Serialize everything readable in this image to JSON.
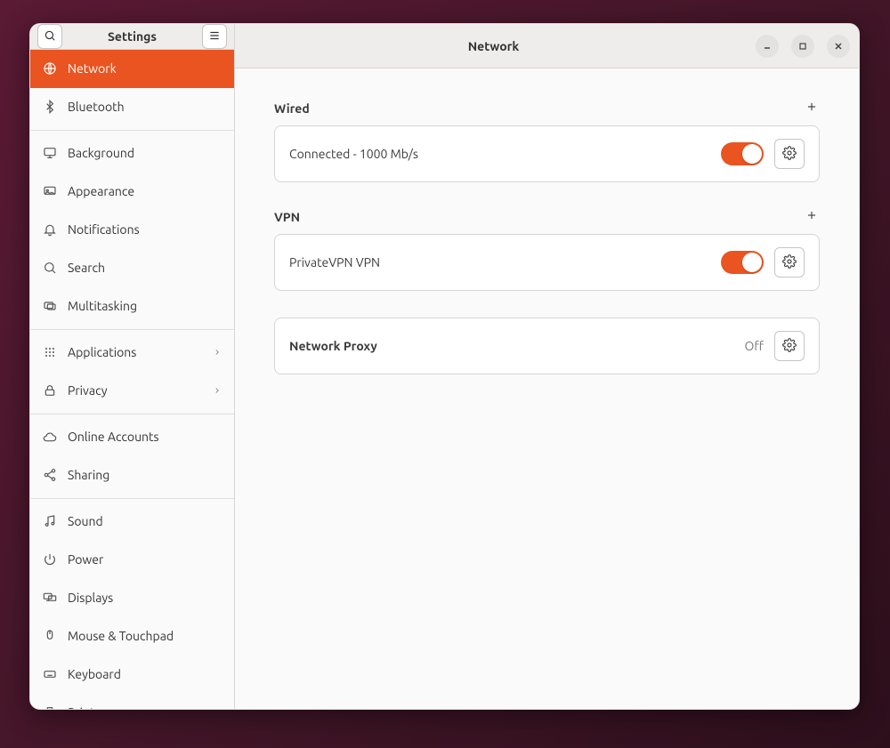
{
  "sidebar": {
    "title": "Settings",
    "items": [
      {
        "icon": "globe",
        "label": "Network",
        "active": true
      },
      {
        "icon": "bluetooth",
        "label": "Bluetooth"
      },
      {
        "sep": true
      },
      {
        "icon": "monitor",
        "label": "Background"
      },
      {
        "icon": "appearance",
        "label": "Appearance"
      },
      {
        "icon": "bell",
        "label": "Notifications"
      },
      {
        "icon": "search",
        "label": "Search"
      },
      {
        "icon": "multitask",
        "label": "Multitasking"
      },
      {
        "sep": true
      },
      {
        "icon": "grid",
        "label": "Applications",
        "chevron": true
      },
      {
        "icon": "lock",
        "label": "Privacy",
        "chevron": true
      },
      {
        "sep": true
      },
      {
        "icon": "cloud",
        "label": "Online Accounts"
      },
      {
        "icon": "share",
        "label": "Sharing"
      },
      {
        "sep": true
      },
      {
        "icon": "note",
        "label": "Sound"
      },
      {
        "icon": "power",
        "label": "Power"
      },
      {
        "icon": "displays",
        "label": "Displays"
      },
      {
        "icon": "mouse",
        "label": "Mouse & Touchpad"
      },
      {
        "icon": "keyboard",
        "label": "Keyboard"
      },
      {
        "icon": "printer",
        "label": "Printers"
      }
    ]
  },
  "main": {
    "title": "Network",
    "wired": {
      "heading": "Wired",
      "status": "Connected - 1000 Mb/s",
      "toggle_on": true
    },
    "vpn": {
      "heading": "VPN",
      "name": "PrivateVPN VPN",
      "toggle_on": true
    },
    "proxy": {
      "heading": "Network Proxy",
      "status": "Off"
    }
  }
}
